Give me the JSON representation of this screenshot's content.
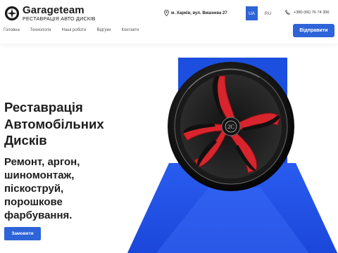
{
  "brand": {
    "name": "Garageteam",
    "tagline": "РЕСТАВРАЦІЯ АВТО ДИСКІВ",
    "logo_icon": "wheel-logo-icon"
  },
  "header": {
    "address": "м. Харків, вул. Вишнева 27",
    "languages": [
      {
        "label": "UA",
        "active": true
      },
      {
        "label": "RU",
        "active": false
      }
    ],
    "phone": "+380 (66) 76 74 300",
    "cta_label": "Відправити"
  },
  "nav": {
    "items": [
      "Головна",
      "Технологія",
      "Наші роботи",
      "Відгуки",
      "Контакти"
    ]
  },
  "hero": {
    "headline_lines": [
      "Реставрація",
      "Автомобільних",
      "Дисків"
    ],
    "subline_lines": [
      "Ремонт, аргон,",
      "шиномонтаж,",
      "піскоструй,",
      "порошкове",
      "фарбування."
    ],
    "cta_label": "Замовити",
    "image": "red-black-alloy-wheel-on-blue-background"
  },
  "colors": {
    "accent": "#2f63d8",
    "hero_blue": "#1c4fe0",
    "spoke_red": "#d8242c",
    "text": "#1d1d1d"
  }
}
